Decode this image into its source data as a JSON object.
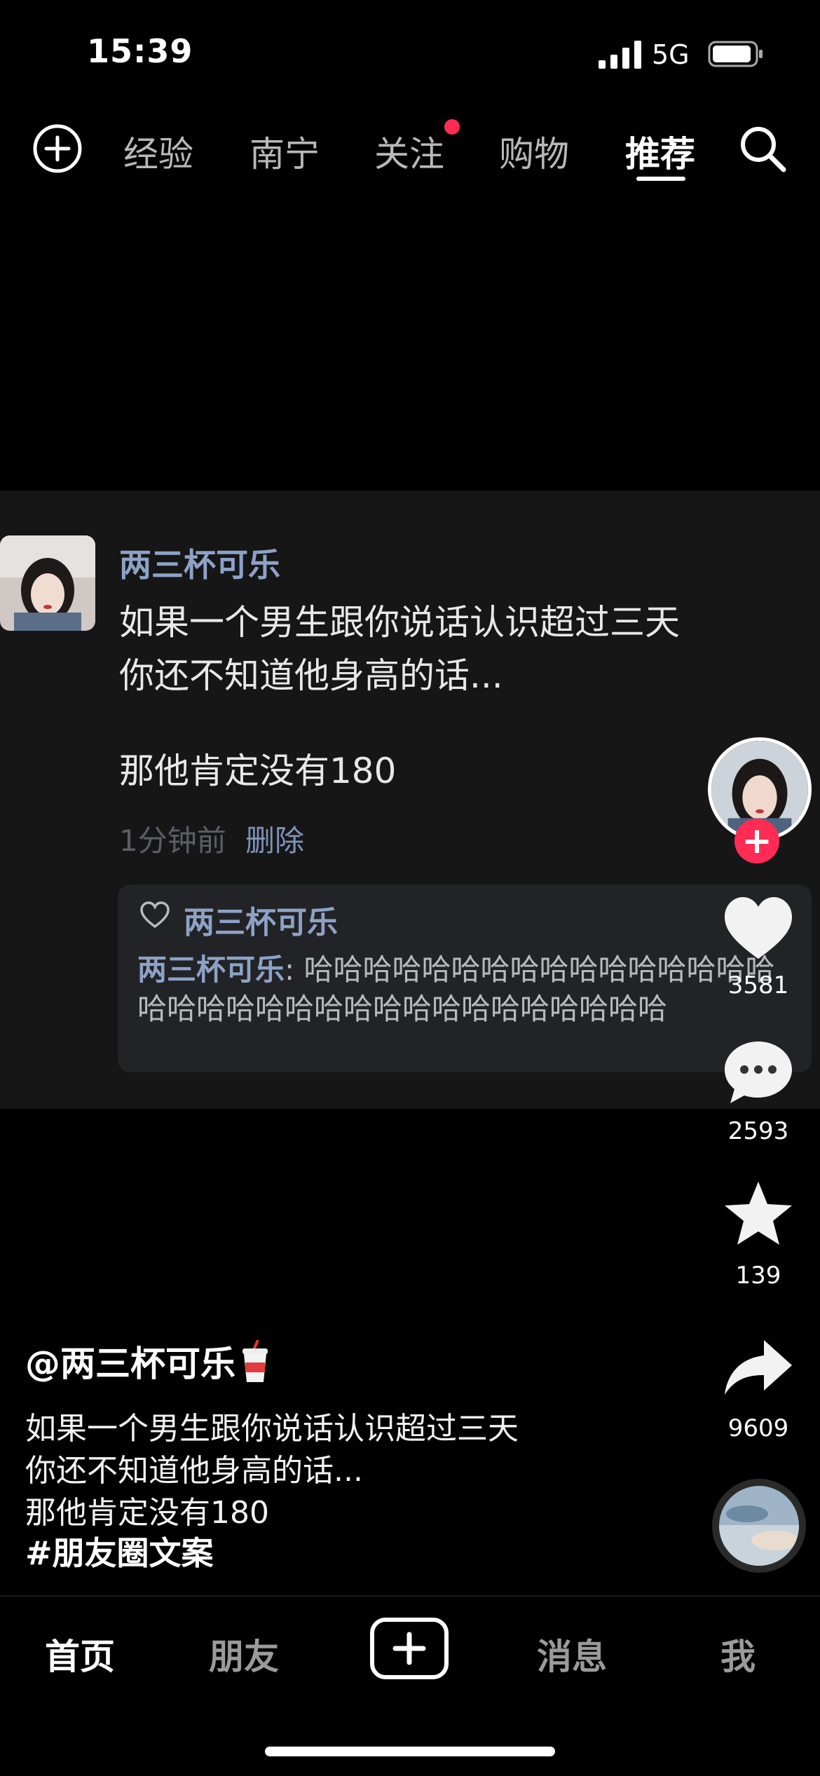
{
  "status_bar": {
    "time": "15:39",
    "network": "5G"
  },
  "top_tabs": [
    "经验",
    "南宁",
    "关注",
    "购物",
    "推荐"
  ],
  "active_tab": "推荐",
  "comment": {
    "username": "两三杯可乐",
    "text": "如果一个男生跟你说话认识超过三天\n你还不知道他身高的话...",
    "text2": "那他肯定没有180",
    "time": "1分钟前",
    "delete_label": "删除",
    "reply": {
      "liked_by": "两三杯可乐",
      "name": "两三杯可乐",
      "separator": ": ",
      "body": "哈哈哈哈哈哈哈哈哈哈哈哈哈哈哈哈哈哈哈哈哈哈哈哈哈哈哈哈哈哈哈哈哈哈"
    }
  },
  "actions": {
    "likes": "3581",
    "comments": "2593",
    "favorites": "139",
    "shares": "9609"
  },
  "caption": {
    "username": "@两三杯可乐",
    "lines": [
      "如果一个男生跟你说话认识超过三天",
      "你还不知道他身高的话...",
      "那他肯定没有180"
    ],
    "hashtag": "#朋友圈文案"
  },
  "bottom_nav": {
    "home": "首页",
    "friends": "朋友",
    "messages": "消息",
    "me": "我"
  },
  "colors": {
    "accent_red": "#fe2c55",
    "username_blue": "#8ea2c6"
  }
}
